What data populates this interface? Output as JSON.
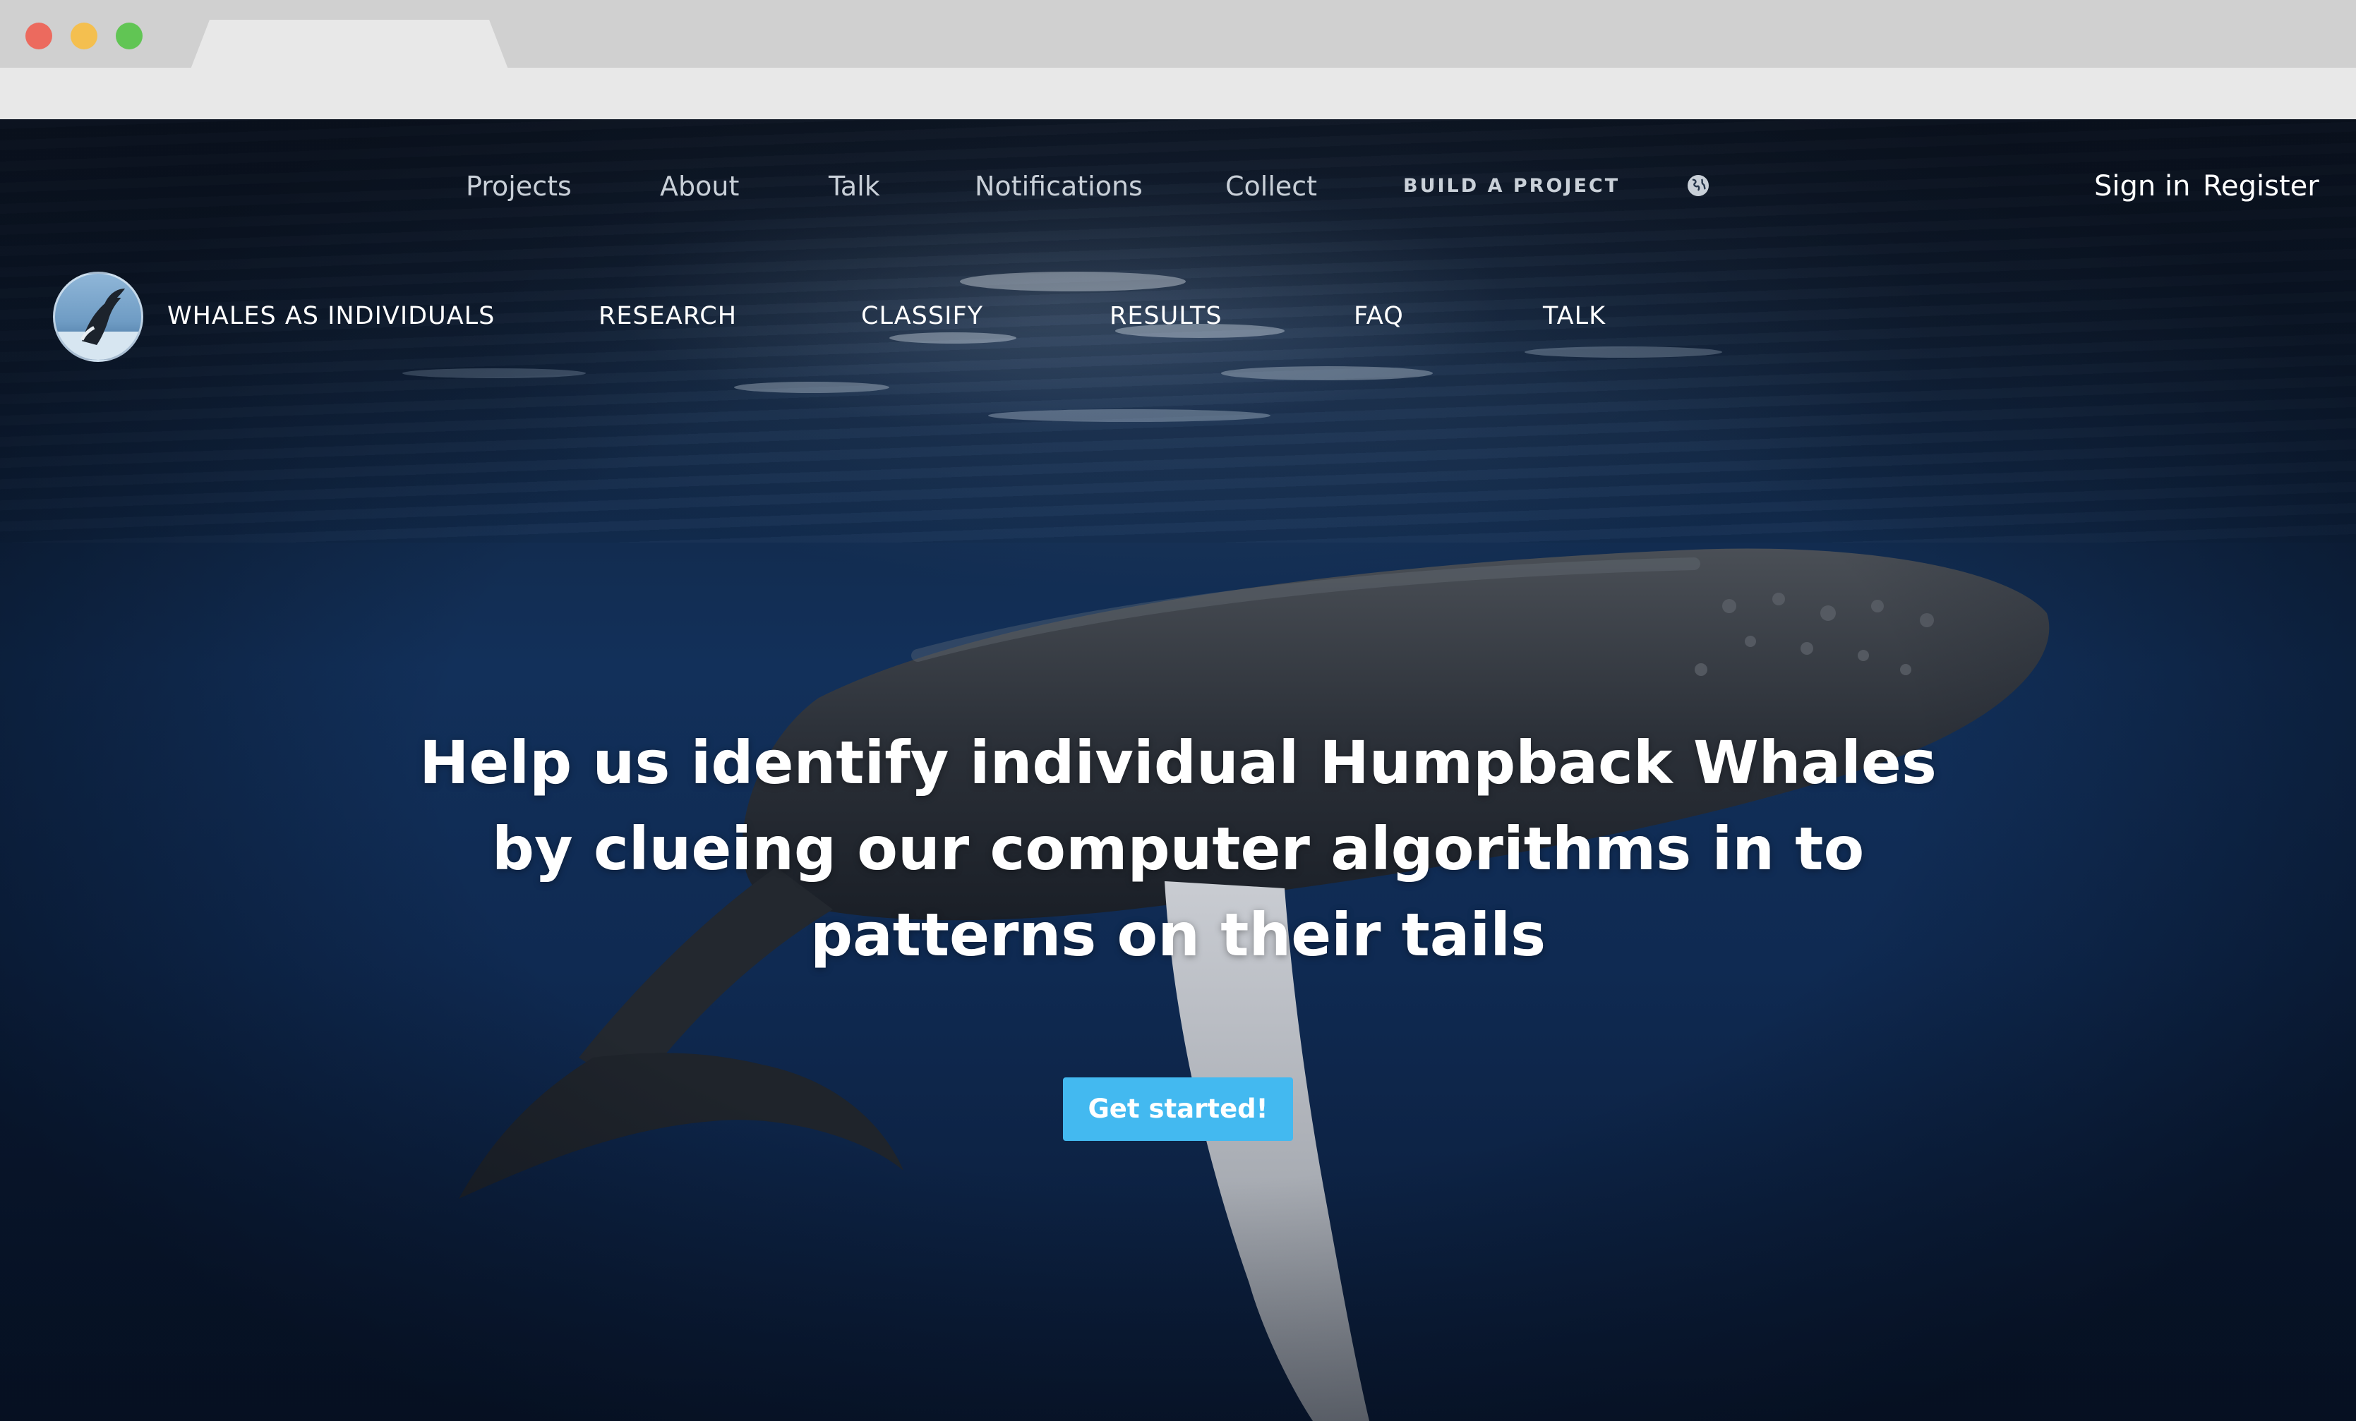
{
  "browser": {
    "window_controls": [
      "close",
      "minimize",
      "maximize"
    ]
  },
  "topnav": {
    "links": [
      {
        "label": "Projects"
      },
      {
        "label": "About"
      },
      {
        "label": "Talk"
      },
      {
        "label": "Notifications"
      },
      {
        "label": "Collect"
      }
    ],
    "build_label": "BUILD A PROJECT",
    "globe_icon": "globe-icon",
    "sign_in": "Sign in",
    "register": "Register"
  },
  "project_nav": {
    "title": "WHALES AS INDIVIDUALS",
    "links": [
      {
        "label": "RESEARCH"
      },
      {
        "label": "CLASSIFY"
      },
      {
        "label": "RESULTS"
      },
      {
        "label": "FAQ"
      },
      {
        "label": "TALK"
      }
    ]
  },
  "hero": {
    "headline": "Help us identify individual Humpback Whales by clueing our computer algorithms in to patterns on their tails",
    "cta_label": "Get started!"
  },
  "colors": {
    "cta": "#43b9f0",
    "ocean_dark": "#0c1626",
    "ocean_mid": "#12305a",
    "nav_text": "#c9d0d8"
  }
}
